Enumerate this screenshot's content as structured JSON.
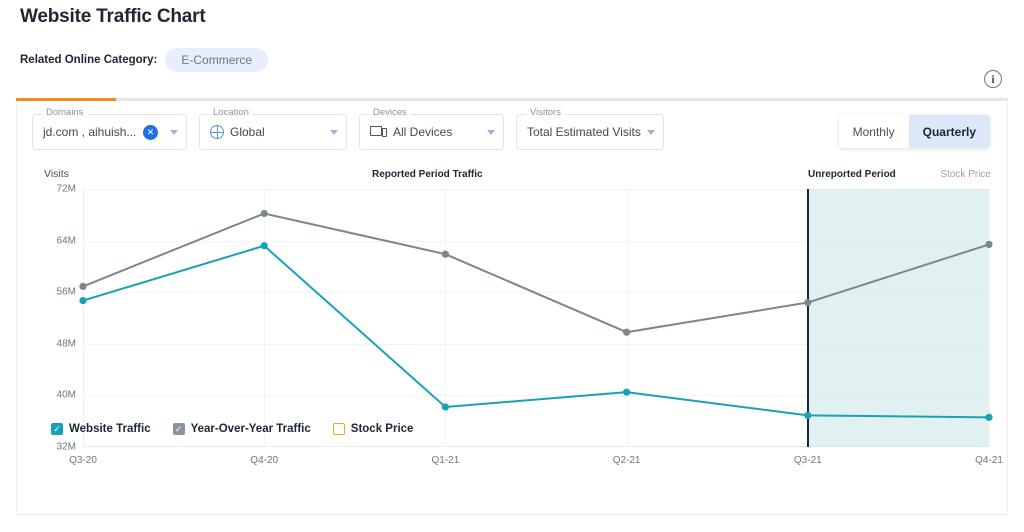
{
  "header": {
    "title": "Website Traffic Chart",
    "category_label": "Related Online Category:",
    "category_value": "E-Commerce",
    "info_icon": "info-icon",
    "info_glyph": "i"
  },
  "filters": [
    {
      "legend": "Domains",
      "value": "jd.com , aihuish...",
      "icon": "none",
      "has_clear": true,
      "clear_glyph": "✕"
    },
    {
      "legend": "Location",
      "value": "Global",
      "icon": "globe-icon",
      "has_clear": false
    },
    {
      "legend": "Devices",
      "value": "All Devices",
      "icon": "devices-icon",
      "has_clear": false
    },
    {
      "legend": "Visitors",
      "value": "Total Estimated Visits",
      "icon": "none",
      "has_clear": false
    }
  ],
  "granularity_toggle": {
    "options": [
      "Monthly",
      "Quarterly"
    ],
    "selected": "Quarterly"
  },
  "legend": [
    {
      "label": "Website Traffic",
      "color": "#17a2b8",
      "checked": true,
      "glyph": "✓"
    },
    {
      "label": "Year-Over-Year Traffic",
      "color": "#8a949e",
      "checked": true,
      "glyph": "✓"
    },
    {
      "label": "Stock Price",
      "color": "#f5a623",
      "checked": false,
      "glyph": ""
    }
  ],
  "chart_data": {
    "type": "line",
    "title": "",
    "axis_name": "Visits",
    "annotations": {
      "reported": "Reported Period Traffic",
      "unreported": "Unreported Period",
      "right_axis": "Stock Price"
    },
    "categories": [
      "Q3-20",
      "Q4-20",
      "Q1-21",
      "Q2-21",
      "Q3-21",
      "Q4-21"
    ],
    "ytick_labels": [
      "72M",
      "64M",
      "56M",
      "48M",
      "40M",
      "32M"
    ],
    "yticks": [
      72,
      64,
      56,
      48,
      40,
      32
    ],
    "ylim": [
      32,
      72
    ],
    "ylabel": "Visits",
    "xlabel": "",
    "grid": true,
    "legend_position": "bottom-left",
    "unreported_from": "Q3-21",
    "series": [
      {
        "name": "Website Traffic",
        "color": "#17a2b8",
        "values": [
          54.7,
          63.2,
          38.2,
          40.5,
          36.9,
          36.6
        ]
      },
      {
        "name": "Year-Over-Year Traffic",
        "color": "#7c868f",
        "values": [
          56.9,
          68.2,
          61.9,
          49.8,
          54.4,
          63.4
        ]
      }
    ]
  }
}
